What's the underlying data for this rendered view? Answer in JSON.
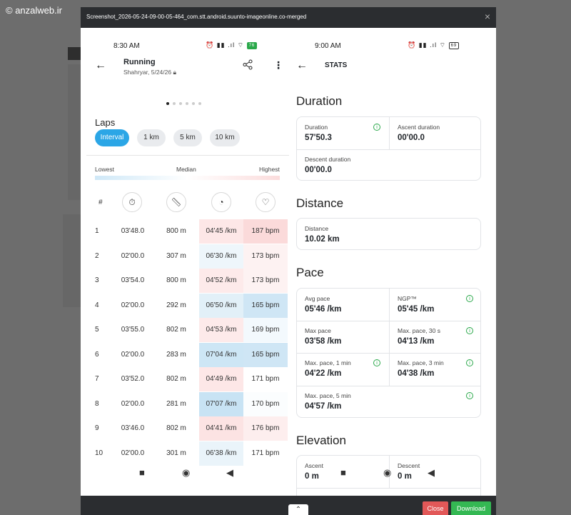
{
  "watermark": "© anzalweb.ir",
  "modal": {
    "title": "Screenshot_2026-05-24-09-00-05-464_com.stt.android.suunto-imageonline.co-merged",
    "close_icon": "×",
    "collapse_icon": "⌃",
    "close_label": "Close",
    "download_label": "Download"
  },
  "left": {
    "time": "8:30 AM",
    "status_icons": "⏰ ▮▮ .ıl ⌔",
    "battery": "76",
    "title": "Running",
    "subtitle": "Shahryar, 5/24/26",
    "laps_heading": "Laps",
    "chips": [
      "Interval",
      "1 km",
      "5 km",
      "10 km"
    ],
    "legend": {
      "low": "Lowest",
      "mid": "Median",
      "high": "Highest"
    },
    "hash": "#",
    "laps": [
      {
        "n": "1",
        "time": "03'48.0",
        "dist": "800 m",
        "pace": "04'45 /km",
        "hr": "187 bpm",
        "pace_bg": "#fde7e7",
        "hr_bg": "#fbdada"
      },
      {
        "n": "2",
        "time": "02'00.0",
        "dist": "307 m",
        "pace": "06'30 /km",
        "hr": "173 bpm",
        "pace_bg": "#eef6fb",
        "hr_bg": "#fdf2f2"
      },
      {
        "n": "3",
        "time": "03'54.0",
        "dist": "800 m",
        "pace": "04'52 /km",
        "hr": "173 bpm",
        "pace_bg": "#fdeaea",
        "hr_bg": "#fdf2f2"
      },
      {
        "n": "4",
        "time": "02'00.0",
        "dist": "292 m",
        "pace": "06'50 /km",
        "hr": "165 bpm",
        "pace_bg": "#e2f0f8",
        "hr_bg": "#cfe6f5"
      },
      {
        "n": "5",
        "time": "03'55.0",
        "dist": "802 m",
        "pace": "04'53 /km",
        "hr": "169 bpm",
        "pace_bg": "#fdeaea",
        "hr_bg": "#f3f9fd"
      },
      {
        "n": "6",
        "time": "02'00.0",
        "dist": "283 m",
        "pace": "07'04 /km",
        "hr": "165 bpm",
        "pace_bg": "#cde6f5",
        "hr_bg": "#cfe6f5"
      },
      {
        "n": "7",
        "time": "03'52.0",
        "dist": "802 m",
        "pace": "04'49 /km",
        "hr": "171 bpm",
        "pace_bg": "#fde7e7",
        "hr_bg": "#ffffff"
      },
      {
        "n": "8",
        "time": "02'00.0",
        "dist": "281 m",
        "pace": "07'07 /km",
        "hr": "170 bpm",
        "pace_bg": "#c8e3f4",
        "hr_bg": "#fbfdfe"
      },
      {
        "n": "9",
        "time": "03'46.0",
        "dist": "802 m",
        "pace": "04'41 /km",
        "hr": "176 bpm",
        "pace_bg": "#fce3e3",
        "hr_bg": "#fdeeee"
      },
      {
        "n": "10",
        "time": "02'00.0",
        "dist": "301 m",
        "pace": "06'38 /km",
        "hr": "171 bpm",
        "pace_bg": "#eaf4fa",
        "hr_bg": "#ffffff"
      }
    ]
  },
  "right": {
    "time": "9:00 AM",
    "status_icons": "⏰ ▮▮ .ıl ⌔",
    "battery": "69",
    "title": "STATS",
    "duration": {
      "heading": "Duration",
      "duration_label": "Duration",
      "duration_value": "57'50.3",
      "ascent_label": "Ascent duration",
      "ascent_value": "00'00.0",
      "descent_label": "Descent duration",
      "descent_value": "00'00.0"
    },
    "distance": {
      "heading": "Distance",
      "label": "Distance",
      "value": "10.02 km"
    },
    "pace": {
      "heading": "Pace",
      "avg_label": "Avg pace",
      "avg_value": "05'46 /km",
      "ngp_label": "NGP™",
      "ngp_value": "05'45 /km",
      "max_label": "Max pace",
      "max_value": "03'58 /km",
      "max30_label": "Max. pace, 30 s",
      "max30_value": "04'13 /km",
      "max1_label": "Max. pace, 1 min",
      "max1_value": "04'22 /km",
      "max3_label": "Max. pace, 3 min",
      "max3_value": "04'38 /km",
      "max5_label": "Max. pace, 5 min",
      "max5_value": "04'57 /km"
    },
    "elevation": {
      "heading": "Elevation",
      "ascent_label": "Ascent",
      "ascent_value": "0 m",
      "descent_label": "Descent",
      "descent_value": "0 m"
    }
  }
}
